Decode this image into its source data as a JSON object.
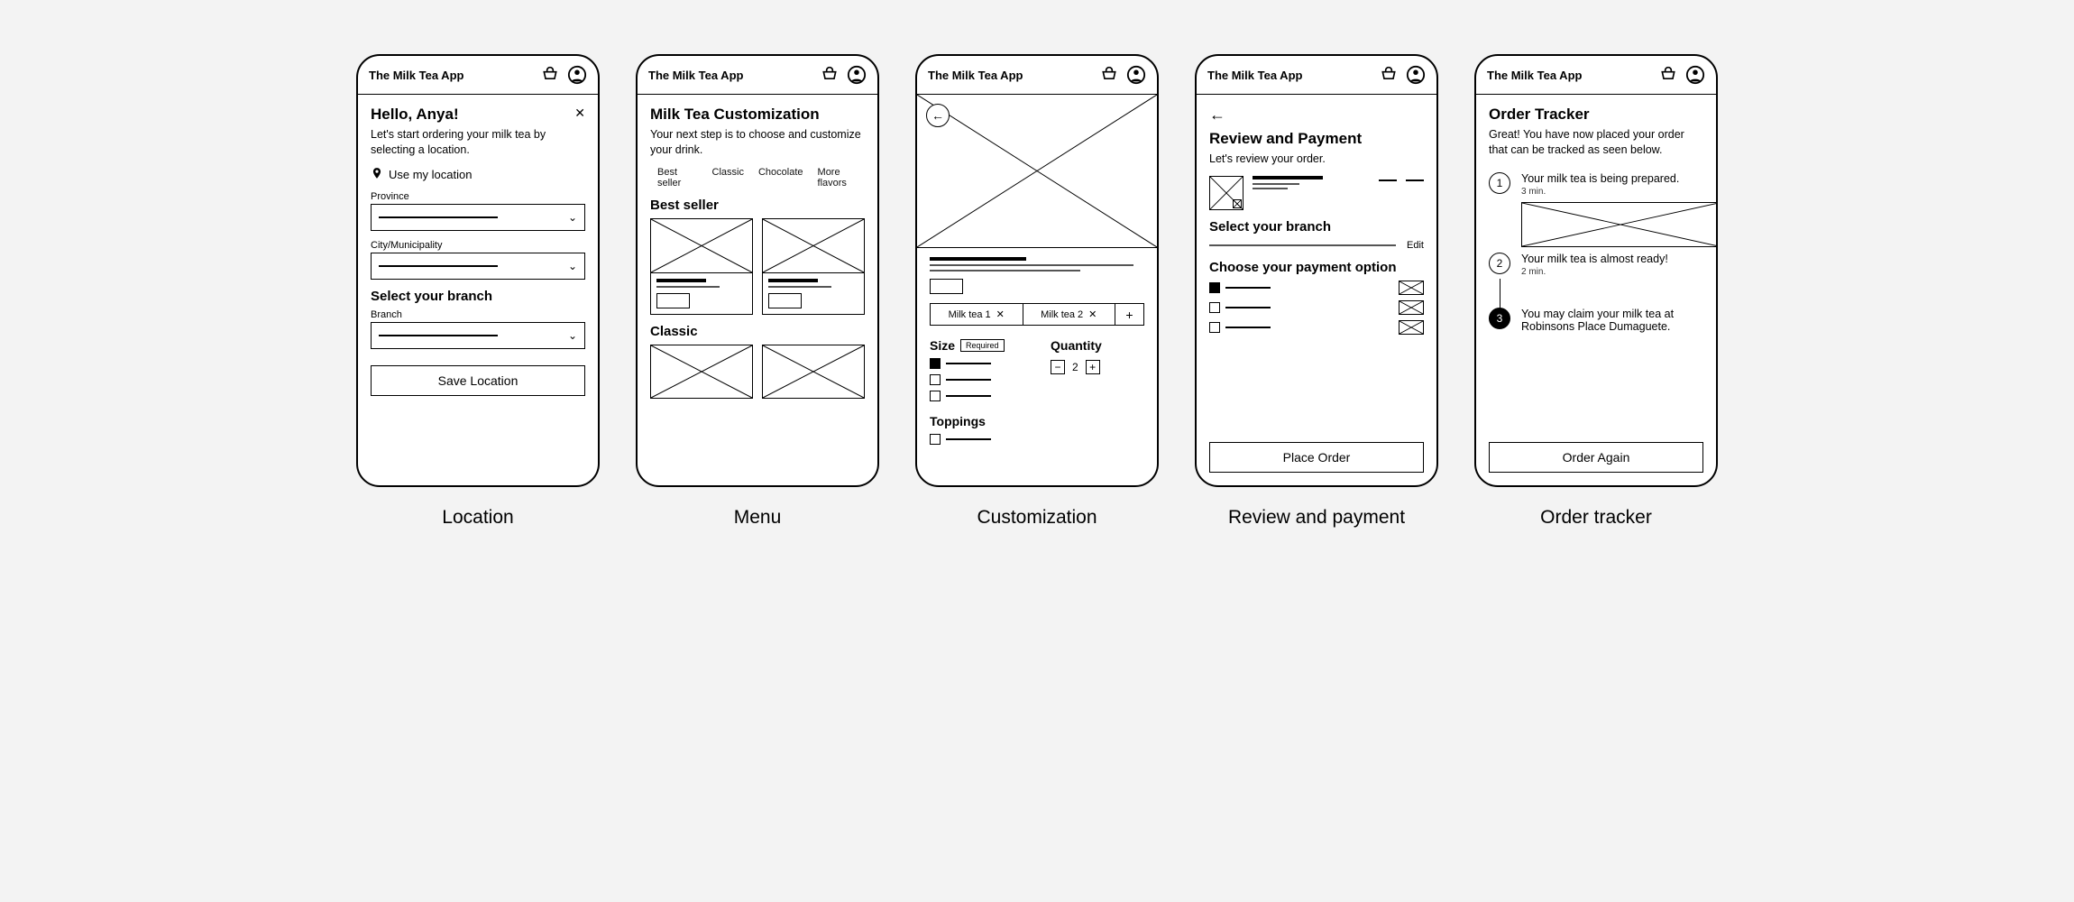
{
  "app_title": "The Milk Tea App",
  "screens": {
    "location": {
      "caption": "Location",
      "greeting": "Hello, Anya!",
      "intro": "Let's start ordering your milk tea by selecting a location.",
      "use_my_location": "Use my location",
      "province_label": "Province",
      "city_label": "City/Municipality",
      "select_branch_heading": "Select your branch",
      "branch_label": "Branch",
      "save_btn": "Save Location"
    },
    "menu": {
      "caption": "Menu",
      "heading": "Milk Tea Customization",
      "intro": "Your next step is to choose and customize your drink.",
      "tabs": [
        "Best seller",
        "Classic",
        "Chocolate",
        "More flavors"
      ],
      "section_best": "Best seller",
      "section_classic": "Classic"
    },
    "custom": {
      "caption": "Customization",
      "tea_tabs": [
        "Milk tea 1",
        "Milk tea 2"
      ],
      "size_label": "Size",
      "required_badge": "Required",
      "quantity_label": "Quantity",
      "quantity_value": "2",
      "toppings_label": "Toppings"
    },
    "review": {
      "caption": "Review and payment",
      "heading": "Review and Payment",
      "intro": "Let's review your order.",
      "branch_heading": "Select your branch",
      "edit_label": "Edit",
      "payment_heading": "Choose your payment option",
      "place_btn": "Place Order"
    },
    "tracker": {
      "caption": "Order tracker",
      "heading": "Order Tracker",
      "intro": "Great! You have now placed your order that can be tracked as seen below.",
      "steps": [
        {
          "num": "1",
          "text": "Your milk tea is being prepared.",
          "time": "3 min."
        },
        {
          "num": "2",
          "text": "Your milk tea is almost ready!",
          "time": "2 min."
        },
        {
          "num": "3",
          "text": "You may claim your milk tea at Robinsons Place Dumaguete.",
          "time": ""
        }
      ],
      "again_btn": "Order Again"
    }
  }
}
